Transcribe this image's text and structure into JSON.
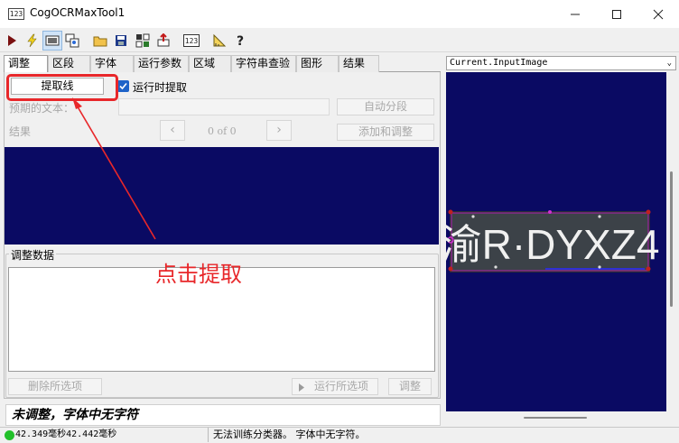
{
  "window": {
    "title": "CogOCRMaxTool1",
    "icon_text": "123",
    "controls": [
      "minimize-icon",
      "maximize-icon",
      "close-icon"
    ]
  },
  "toolbar": {
    "buttons": [
      {
        "name": "run-icon",
        "glyph": "▶"
      },
      {
        "name": "lightning-icon",
        "glyph": "⚡"
      },
      {
        "name": "image-display-icon",
        "glyph": "▣"
      },
      {
        "name": "image-copy-icon",
        "glyph": "⧉"
      },
      {
        "name": "open-folder-icon",
        "glyph": "📂"
      },
      {
        "name": "save-icon",
        "glyph": "💾"
      },
      {
        "name": "grid-icon",
        "glyph": "▦"
      },
      {
        "name": "import-icon",
        "glyph": "⤒"
      },
      {
        "name": "ocr-font-icon",
        "glyph": "123"
      },
      {
        "name": "ruler-icon",
        "glyph": "📐"
      },
      {
        "name": "help-icon",
        "glyph": "?"
      }
    ]
  },
  "tabs": [
    "调整",
    "区段",
    "字体",
    "运行参数",
    "区域",
    "字符串查验",
    "图形",
    "结果"
  ],
  "tune": {
    "extract_button": "提取线",
    "run_extract_checkbox": "运行时提取",
    "expected_text_label": "预期的文本：",
    "auto_segment_button": "自动分段",
    "result_label": "结果",
    "prev_icon": "‹",
    "next_icon": "›",
    "pager_text": "0 of 0",
    "add_tune_button": "添加和调整",
    "tune_data_label": "调整数据",
    "delete_selected_button": "删除所选项",
    "run_selected_button": "运行所选项",
    "tune_button": "调整"
  },
  "annotation": {
    "text": "点击提取",
    "color": "#e8272a"
  },
  "status": {
    "message": "未调整，字体中无字符",
    "timing": "42.349毫秒42.442毫秒",
    "classifier": "无法训练分类器。 字体中无字符。",
    "indicator_color": "#22c02a"
  },
  "image_pane": {
    "selector": "Current.InputImage",
    "plate_text": "渝R·DYXZ4"
  },
  "colors": {
    "dark_blue": "#0a0a63",
    "checkbox": "#1e63c8"
  }
}
